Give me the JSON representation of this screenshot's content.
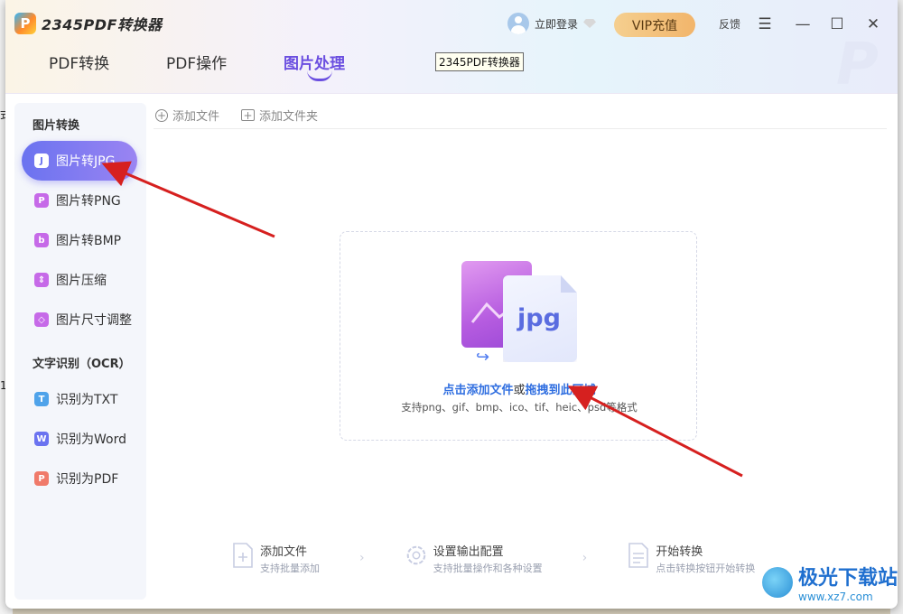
{
  "app": {
    "title": "2345PDF转换器",
    "logo_letter": "P",
    "login_label": "立即登录",
    "vip_label": "VIP充值",
    "feedback_label": "反馈",
    "window_controls": {
      "menu": "☰",
      "minimize": "—",
      "maximize": "☐",
      "close": "✕"
    },
    "tooltip": "2345PDF转换器",
    "accent_color": "#6b4fe0"
  },
  "tabs": [
    {
      "label": "PDF转换",
      "active": false
    },
    {
      "label": "PDF操作",
      "active": false
    },
    {
      "label": "图片处理",
      "active": true
    }
  ],
  "sidebar": {
    "section1_title": "图片转换",
    "section2_title": "文字识别（OCR）",
    "items": [
      {
        "label": "图片转JPG",
        "icon": "J",
        "color": "#6b73f0",
        "active": true
      },
      {
        "label": "图片转PNG",
        "icon": "P",
        "color": "#c66ae8",
        "active": false
      },
      {
        "label": "图片转BMP",
        "icon": "b",
        "color": "#c66ae8",
        "active": false
      },
      {
        "label": "图片压缩",
        "icon": "⇕",
        "color": "#c66ae8",
        "active": false
      },
      {
        "label": "图片尺寸调整",
        "icon": "◇",
        "color": "#c66ae8",
        "active": false
      },
      {
        "label": "识别为TXT",
        "icon": "T",
        "color": "#4fa3ea",
        "active": false
      },
      {
        "label": "识别为Word",
        "icon": "W",
        "color": "#6b73f0",
        "active": false
      },
      {
        "label": "识别为PDF",
        "icon": "P",
        "color": "#f07a6a",
        "active": false
      }
    ]
  },
  "toolbar": {
    "add_file": "添加文件",
    "add_folder": "添加文件夹"
  },
  "dropzone": {
    "format": "jpg",
    "text_click": "点击添加文件",
    "text_or": "或",
    "text_drag": "拖拽到此区域",
    "formats": "支持png、gif、bmp、ico、tif、heic、psd等格式"
  },
  "steps": [
    {
      "title": "添加文件",
      "desc": "支持批量添加",
      "icon": "file-plus-icon"
    },
    {
      "title": "设置输出配置",
      "desc": "支持批量操作和各种设置",
      "icon": "gear-icon"
    },
    {
      "title": "开始转换",
      "desc": "点击转换按钮开始转换",
      "icon": "document-icon"
    }
  ],
  "watermark": {
    "title": "极光下载站",
    "url": "www.xz7.com"
  },
  "desktop_fragments": {
    "left_top": "式",
    "left_bottom": "1"
  }
}
